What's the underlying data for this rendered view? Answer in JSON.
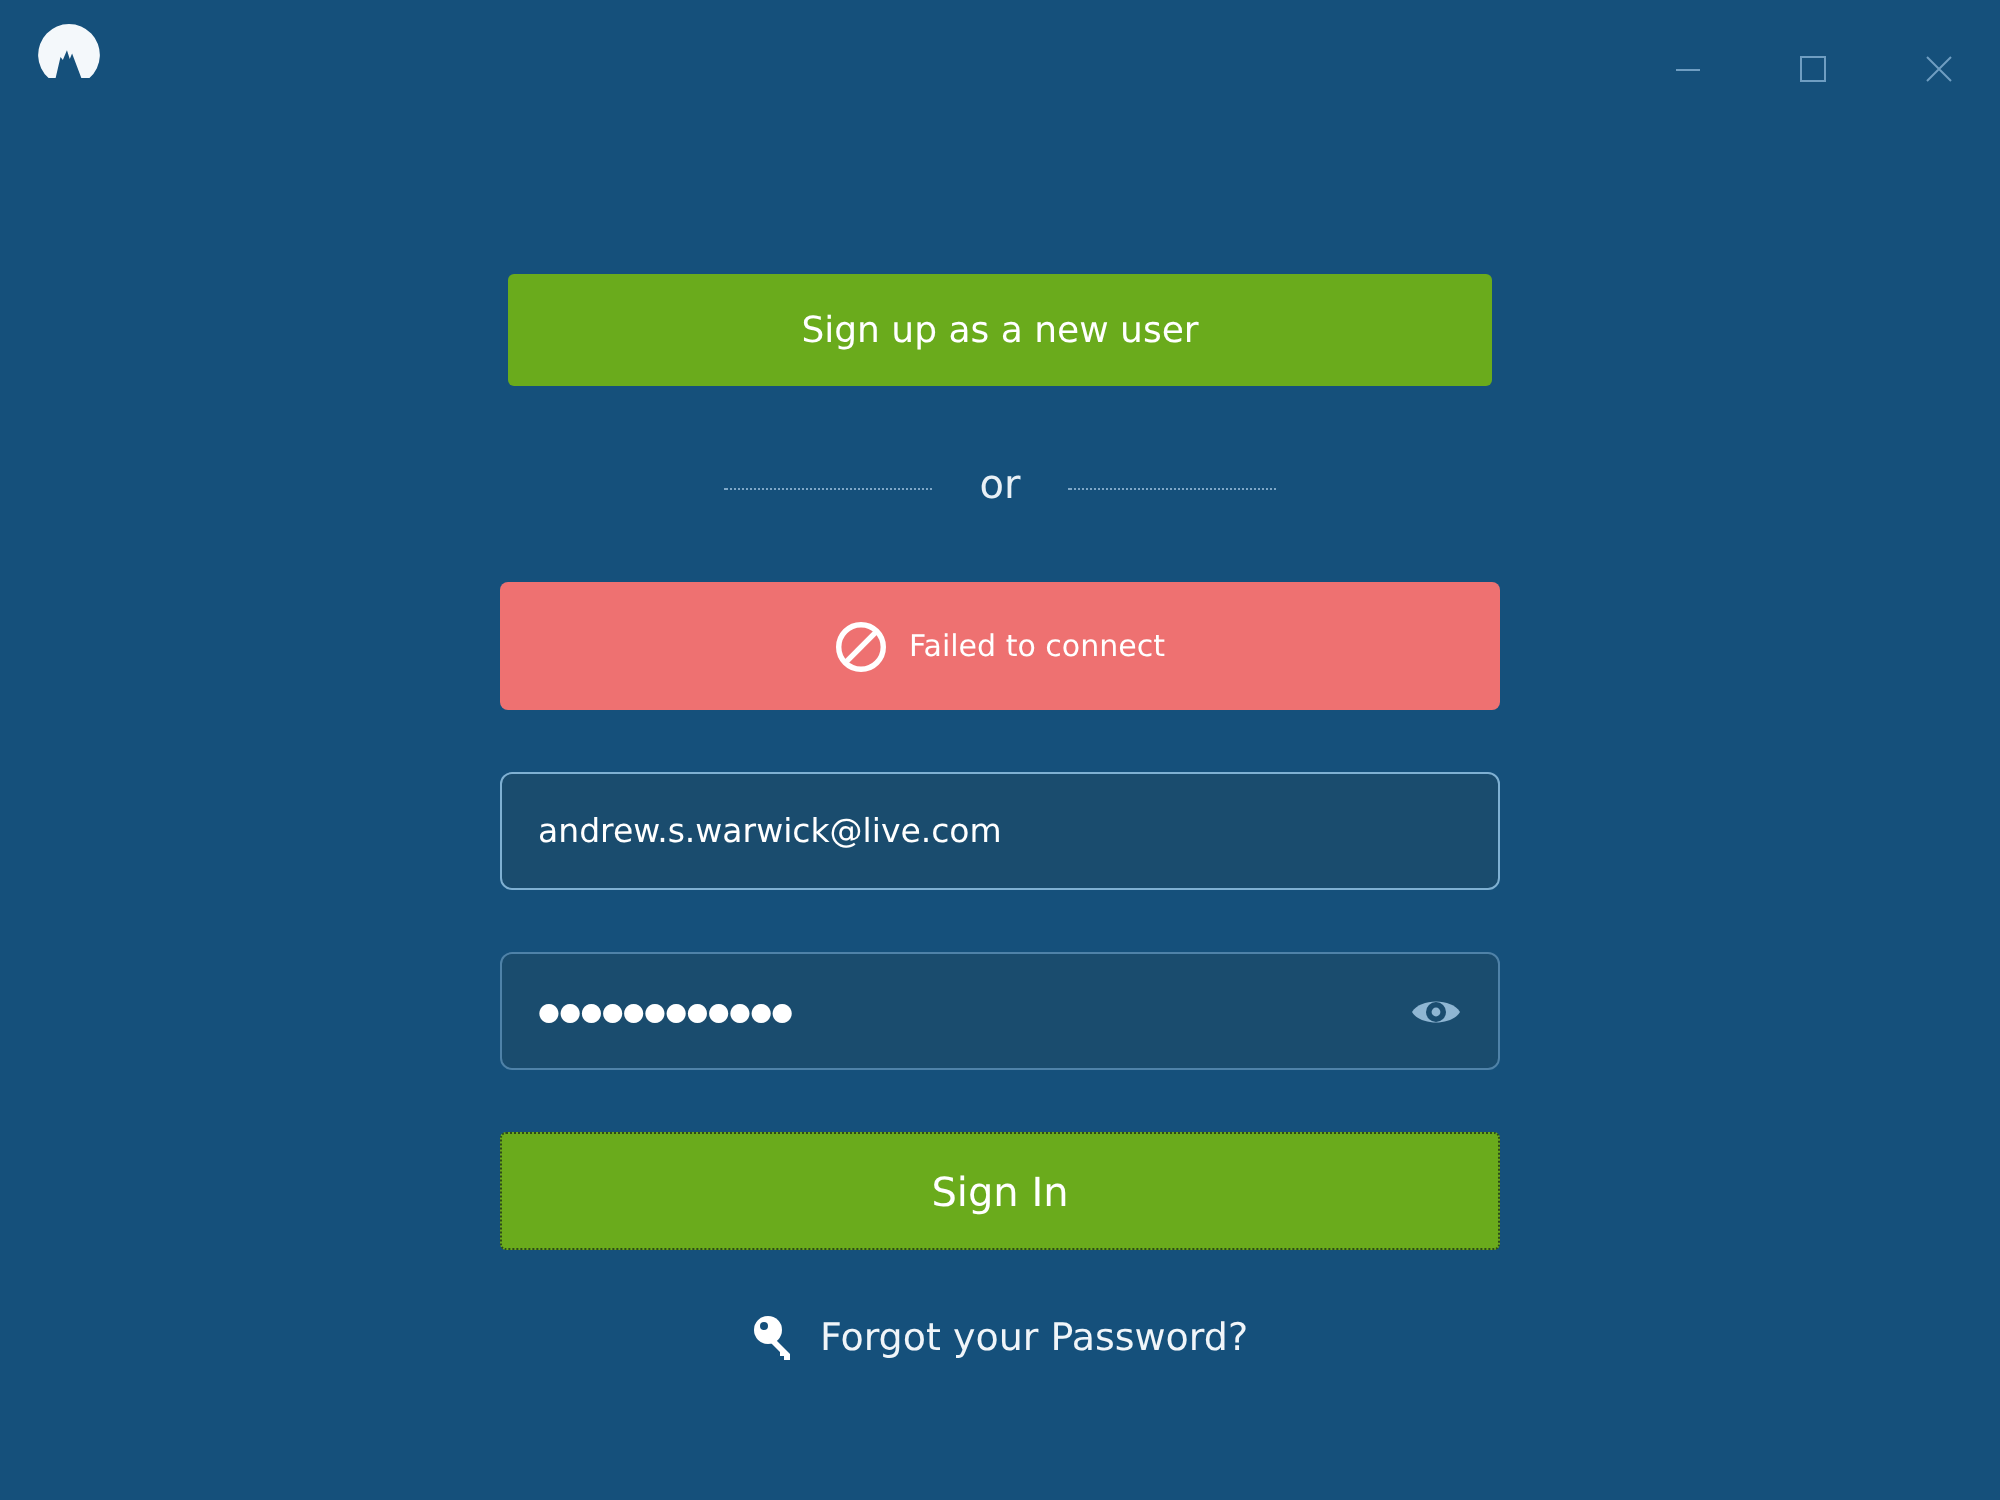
{
  "signup_button": {
    "label": "Sign up as a new user"
  },
  "divider": {
    "label": "or"
  },
  "error_banner": {
    "message": "Failed to connect"
  },
  "email_field": {
    "value": "andrew.s.warwick@live.com"
  },
  "password_field": {
    "value": "●●●●●●●●●●●●"
  },
  "signin_button": {
    "label": "Sign In",
    "focused": true
  },
  "forgot_link": {
    "label": "Forgot your Password?"
  }
}
